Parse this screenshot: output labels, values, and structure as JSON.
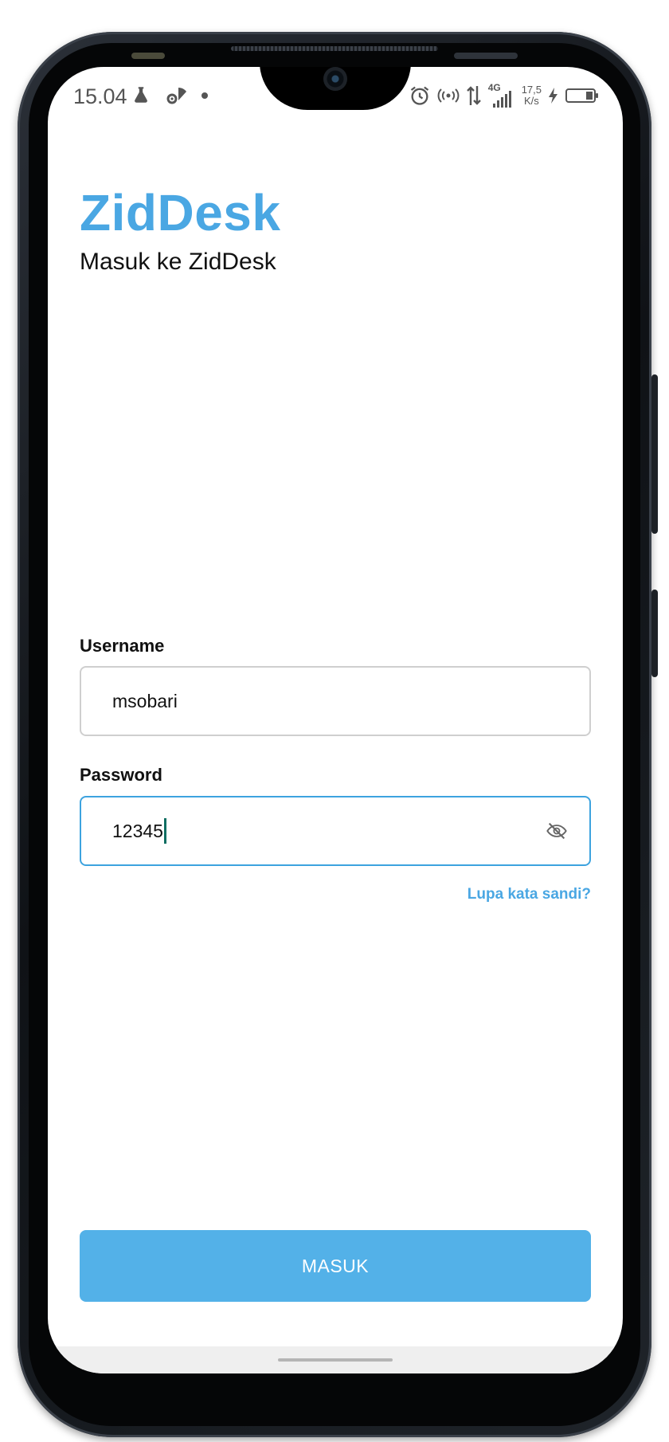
{
  "status_bar": {
    "time": "15.04",
    "network_type": "4G",
    "net_speed_value": "17,5",
    "net_speed_unit": "K/s"
  },
  "app": {
    "title": "ZidDesk",
    "subtitle": "Masuk ke ZidDesk"
  },
  "form": {
    "username_label": "Username",
    "username_value": "msobari",
    "password_label": "Password",
    "password_value": "12345",
    "forgot_label": "Lupa kata sandi?",
    "submit_label": "MASUK"
  },
  "colors": {
    "brand": "#4aa7e3",
    "button": "#53b1e8",
    "focus_border": "#3da3df"
  },
  "icons": {
    "password_toggle": "eye-off-icon",
    "status": [
      "flask-icon",
      "gear-wifi-icon",
      "dot-icon",
      "alarm-icon",
      "hotspot-icon",
      "data-transfer-icon",
      "signal-icon",
      "charging-icon",
      "battery-icon"
    ]
  }
}
